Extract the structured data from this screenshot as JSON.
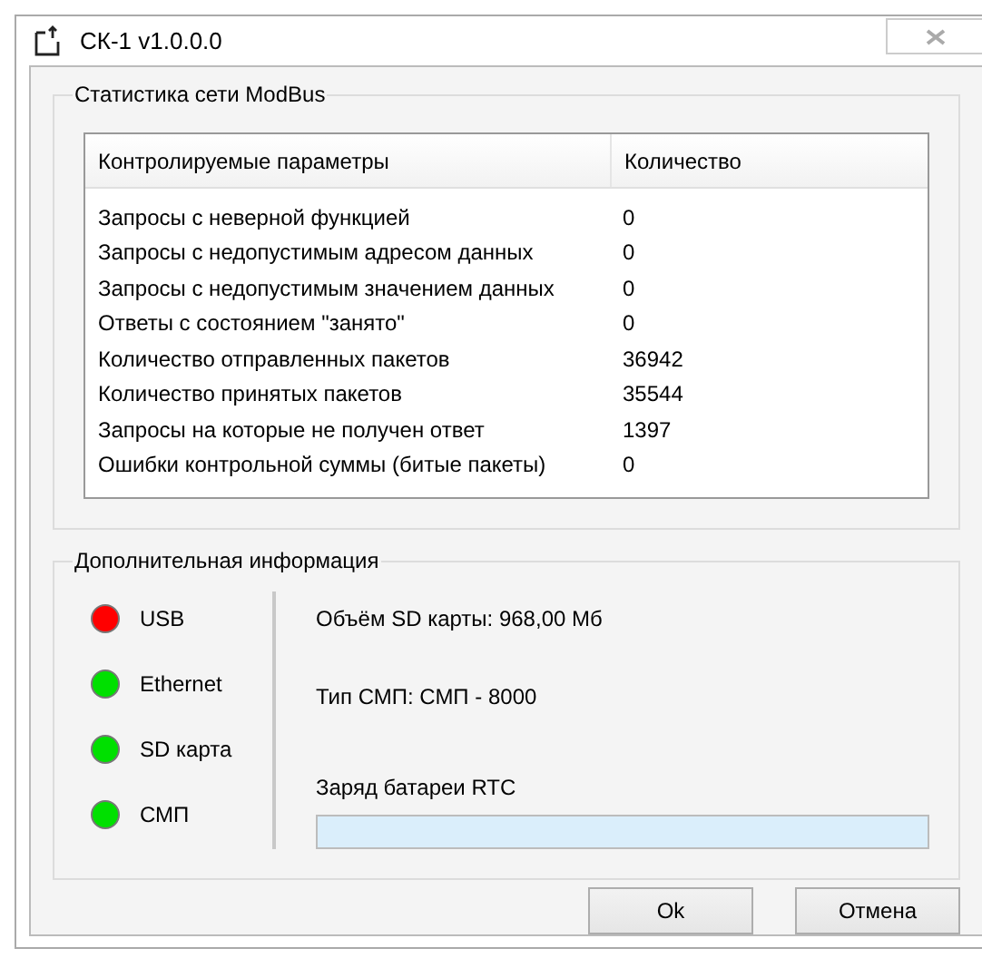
{
  "window": {
    "title": "СК-1 v1.0.0.0"
  },
  "modbus": {
    "title": "Статистика сети ModBus",
    "columns": [
      "Контролируемые параметры",
      "Количество"
    ],
    "rows": [
      [
        "Запросы с неверной функцией",
        "0"
      ],
      [
        "Запросы с недопустимым адресом данных",
        "0"
      ],
      [
        "Запросы с недопустимым значением данных",
        "0"
      ],
      [
        "Ответы с состоянием \"занято\"",
        "0"
      ],
      [
        "Количество отправленных пакетов",
        "36942"
      ],
      [
        "Количество принятых пакетов",
        "35544"
      ],
      [
        "Запросы на которые не получен ответ",
        "1397"
      ],
      [
        "Ошибки контрольной суммы (битые пакеты)",
        "0"
      ]
    ]
  },
  "extra": {
    "title": "Дополнительная информация",
    "indicators": [
      {
        "label": "USB",
        "color": "#ff0000"
      },
      {
        "label": "Ethernet",
        "color": "#00e000"
      },
      {
        "label": "SD карта",
        "color": "#00e000"
      },
      {
        "label": "СМП",
        "color": "#00e000"
      }
    ],
    "sd_size": "Объём SD карты: 968,00 Мб",
    "smp_type": "Тип СМП: СМП - 8000",
    "battery_label": "Заряд батареи RTC",
    "battery": {
      "level": 0
    }
  },
  "buttons": [
    "Ok",
    "Отмена"
  ]
}
